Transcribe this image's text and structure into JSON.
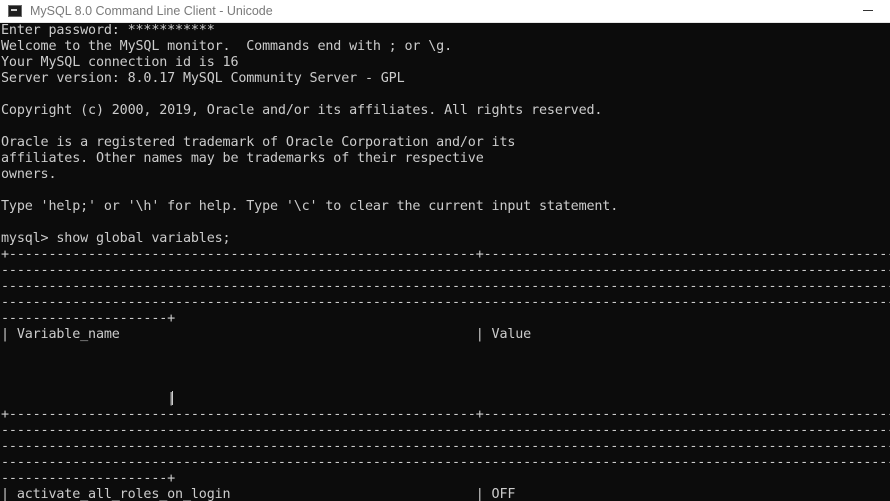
{
  "window": {
    "title": "MySQL 8.0 Command Line Client - Unicode",
    "icon": "mysql-console-icon"
  },
  "console": {
    "lines": [
      "Enter password: ***********",
      "Welcome to the MySQL monitor.  Commands end with ; or \\g.",
      "Your MySQL connection id is 16",
      "Server version: 8.0.17 MySQL Community Server - GPL",
      "",
      "Copyright (c) 2000, 2019, Oracle and/or its affiliates. All rights reserved.",
      "",
      "Oracle is a registered trademark of Oracle Corporation and/or its",
      "affiliates. Other names may be trademarks of their respective",
      "owners.",
      "",
      "Type 'help;' or '\\h' for help. Type '\\c' to clear the current input statement.",
      "",
      "mysql> show global variables;",
      "+-----------------------------------------------------------+-----------------------------------------------------------",
      "--------------------------------------------------------------------------------------------------------------------------",
      "--------------------------------------------------------------------------------------------------------------------------",
      "--------------------------------------------------------------------------------------------------------------------------",
      "---------------------+",
      "| Variable_name                                             | Value",
      "",
      "",
      "",
      "                     |",
      "+-----------------------------------------------------------+-----------------------------------------------------------",
      "--------------------------------------------------------------------------------------------------------------------------",
      "--------------------------------------------------------------------------------------------------------------------------",
      "--------------------------------------------------------------------------------------------------------------------------",
      "---------------------+",
      "| activate_all_roles_on_login                               | OFF"
    ]
  }
}
